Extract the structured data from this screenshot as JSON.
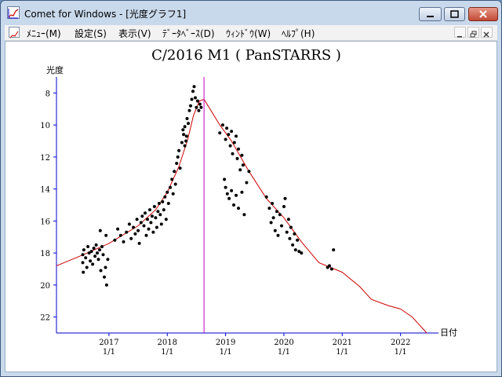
{
  "window": {
    "title": "Comet for Windows - [光度グラフ1]",
    "app_icon": "chart-icon"
  },
  "menu": {
    "items": [
      "ﾒﾆｭｰ(M)",
      "設定(S)",
      "表示(V)",
      "ﾃﾞｰﾀﾍﾞｰｽ(D)",
      "ｳｨﾝﾄﾞｳ(W)",
      "ﾍﾙﾌﾟ(H)"
    ]
  },
  "colors": {
    "axis": "#0000cc",
    "curve": "#cc0000",
    "marker_line": "#cc00cc",
    "points": "#000000"
  },
  "chart_data": {
    "type": "scatter",
    "title": "C/2016 M1 ( PanSTARRS )",
    "ylabel": "光度",
    "xlabel": "日付",
    "y_inverted": true,
    "ylim": [
      23,
      7
    ],
    "xlim": [
      2016.1,
      2022.65
    ],
    "y_ticks": [
      8,
      10,
      12,
      14,
      16,
      18,
      20,
      22
    ],
    "x_ticks": [
      {
        "year": 2017,
        "label_top": "2017",
        "label_bottom": "1/1"
      },
      {
        "year": 2018,
        "label_top": "2018",
        "label_bottom": "1/1"
      },
      {
        "year": 2019,
        "label_top": "2019",
        "label_bottom": "1/1"
      },
      {
        "year": 2020,
        "label_top": "2020",
        "label_bottom": "1/1"
      },
      {
        "year": 2021,
        "label_top": "2021",
        "label_bottom": "1/1"
      },
      {
        "year": 2022,
        "label_top": "2022",
        "label_bottom": "1/1"
      }
    ],
    "perihelion_line_x": 2018.63,
    "model_curve": {
      "x": [
        2016.1,
        2016.5,
        2017.0,
        2017.5,
        2017.8,
        2018.0,
        2018.2,
        2018.35,
        2018.45,
        2018.55,
        2018.63,
        2018.75,
        2018.9,
        2019.1,
        2019.4,
        2019.7,
        2020.0,
        2020.3,
        2020.6,
        2021.0,
        2021.3,
        2021.5,
        2021.8,
        2022.0,
        2022.2,
        2022.45
      ],
      "y": [
        18.8,
        18.2,
        17.4,
        16.3,
        15.3,
        14.2,
        12.6,
        10.9,
        9.4,
        8.5,
        8.4,
        9.1,
        10.0,
        11.0,
        12.9,
        14.6,
        15.8,
        17.3,
        18.6,
        19.2,
        20.1,
        20.9,
        21.3,
        21.5,
        22.0,
        23.0
      ]
    },
    "observations": [
      {
        "x": 2016.55,
        "y": 18.1
      },
      {
        "x": 2016.55,
        "y": 18.6
      },
      {
        "x": 2016.56,
        "y": 19.2
      },
      {
        "x": 2016.57,
        "y": 17.8
      },
      {
        "x": 2016.6,
        "y": 18.3
      },
      {
        "x": 2016.62,
        "y": 18.9
      },
      {
        "x": 2016.64,
        "y": 17.6
      },
      {
        "x": 2016.66,
        "y": 18.0
      },
      {
        "x": 2016.68,
        "y": 18.5
      },
      {
        "x": 2016.7,
        "y": 17.9
      },
      {
        "x": 2016.72,
        "y": 18.7
      },
      {
        "x": 2016.74,
        "y": 17.7
      },
      {
        "x": 2016.76,
        "y": 18.2
      },
      {
        "x": 2016.78,
        "y": 17.5
      },
      {
        "x": 2016.8,
        "y": 18.0
      },
      {
        "x": 2016.82,
        "y": 18.4
      },
      {
        "x": 2016.84,
        "y": 17.8
      },
      {
        "x": 2016.86,
        "y": 19.1
      },
      {
        "x": 2016.88,
        "y": 17.6
      },
      {
        "x": 2016.9,
        "y": 18.1
      },
      {
        "x": 2016.92,
        "y": 19.5
      },
      {
        "x": 2016.94,
        "y": 18.9
      },
      {
        "x": 2016.96,
        "y": 20.0
      },
      {
        "x": 2016.98,
        "y": 18.4
      },
      {
        "x": 2016.85,
        "y": 16.6
      },
      {
        "x": 2016.95,
        "y": 16.9
      },
      {
        "x": 2017.1,
        "y": 17.2
      },
      {
        "x": 2017.15,
        "y": 16.5
      },
      {
        "x": 2017.2,
        "y": 16.9
      },
      {
        "x": 2017.25,
        "y": 17.3
      },
      {
        "x": 2017.3,
        "y": 16.7
      },
      {
        "x": 2017.35,
        "y": 16.2
      },
      {
        "x": 2017.38,
        "y": 17.1
      },
      {
        "x": 2017.42,
        "y": 16.4
      },
      {
        "x": 2017.45,
        "y": 16.8
      },
      {
        "x": 2017.48,
        "y": 15.9
      },
      {
        "x": 2017.5,
        "y": 16.6
      },
      {
        "x": 2017.52,
        "y": 17.4
      },
      {
        "x": 2017.55,
        "y": 16.1
      },
      {
        "x": 2017.57,
        "y": 15.7
      },
      {
        "x": 2017.6,
        "y": 16.3
      },
      {
        "x": 2017.62,
        "y": 15.5
      },
      {
        "x": 2017.64,
        "y": 16.9
      },
      {
        "x": 2017.66,
        "y": 15.9
      },
      {
        "x": 2017.68,
        "y": 16.5
      },
      {
        "x": 2017.7,
        "y": 15.3
      },
      {
        "x": 2017.72,
        "y": 16.1
      },
      {
        "x": 2017.74,
        "y": 15.7
      },
      {
        "x": 2017.76,
        "y": 16.7
      },
      {
        "x": 2017.78,
        "y": 15.1
      },
      {
        "x": 2017.8,
        "y": 15.8
      },
      {
        "x": 2017.82,
        "y": 16.4
      },
      {
        "x": 2017.84,
        "y": 15.4
      },
      {
        "x": 2017.86,
        "y": 14.9
      },
      {
        "x": 2017.88,
        "y": 15.6
      },
      {
        "x": 2017.9,
        "y": 16.2
      },
      {
        "x": 2017.92,
        "y": 14.8
      },
      {
        "x": 2017.94,
        "y": 15.3
      },
      {
        "x": 2017.96,
        "y": 14.5
      },
      {
        "x": 2017.98,
        "y": 15.9
      },
      {
        "x": 2018.0,
        "y": 14.2
      },
      {
        "x": 2018.02,
        "y": 14.9
      },
      {
        "x": 2018.05,
        "y": 13.9
      },
      {
        "x": 2018.08,
        "y": 13.4
      },
      {
        "x": 2018.1,
        "y": 14.3
      },
      {
        "x": 2018.12,
        "y": 12.9
      },
      {
        "x": 2018.14,
        "y": 13.7
      },
      {
        "x": 2018.16,
        "y": 12.4
      },
      {
        "x": 2018.18,
        "y": 12.0
      },
      {
        "x": 2018.2,
        "y": 11.6
      },
      {
        "x": 2018.22,
        "y": 12.7
      },
      {
        "x": 2018.25,
        "y": 11.1
      },
      {
        "x": 2018.28,
        "y": 10.6
      },
      {
        "x": 2018.3,
        "y": 10.1
      },
      {
        "x": 2018.32,
        "y": 11.0
      },
      {
        "x": 2018.34,
        "y": 9.6
      },
      {
        "x": 2018.36,
        "y": 9.9
      },
      {
        "x": 2018.38,
        "y": 9.1
      },
      {
        "x": 2018.4,
        "y": 8.8
      },
      {
        "x": 2018.42,
        "y": 8.4
      },
      {
        "x": 2018.44,
        "y": 7.9
      },
      {
        "x": 2018.46,
        "y": 7.6
      },
      {
        "x": 2018.48,
        "y": 8.3
      },
      {
        "x": 2018.5,
        "y": 8.9
      },
      {
        "x": 2018.52,
        "y": 8.5
      },
      {
        "x": 2018.54,
        "y": 9.1
      },
      {
        "x": 2018.56,
        "y": 8.7
      },
      {
        "x": 2018.58,
        "y": 8.9
      },
      {
        "x": 2018.3,
        "y": 11.3
      },
      {
        "x": 2018.33,
        "y": 10.7
      },
      {
        "x": 2018.27,
        "y": 10.3
      },
      {
        "x": 2018.9,
        "y": 10.5
      },
      {
        "x": 2018.95,
        "y": 10.0
      },
      {
        "x": 2019.0,
        "y": 10.9
      },
      {
        "x": 2019.02,
        "y": 10.2
      },
      {
        "x": 2019.05,
        "y": 10.6
      },
      {
        "x": 2019.08,
        "y": 11.3
      },
      {
        "x": 2019.1,
        "y": 10.4
      },
      {
        "x": 2019.12,
        "y": 11.8
      },
      {
        "x": 2019.15,
        "y": 11.1
      },
      {
        "x": 2019.18,
        "y": 10.7
      },
      {
        "x": 2019.2,
        "y": 12.1
      },
      {
        "x": 2019.22,
        "y": 11.5
      },
      {
        "x": 2019.25,
        "y": 12.8
      },
      {
        "x": 2019.28,
        "y": 11.9
      },
      {
        "x": 2019.3,
        "y": 12.5
      },
      {
        "x": 2018.98,
        "y": 13.4
      },
      {
        "x": 2019.0,
        "y": 13.9
      },
      {
        "x": 2019.03,
        "y": 14.3
      },
      {
        "x": 2019.06,
        "y": 14.6
      },
      {
        "x": 2019.1,
        "y": 14.1
      },
      {
        "x": 2019.14,
        "y": 15.0
      },
      {
        "x": 2019.18,
        "y": 14.4
      },
      {
        "x": 2019.22,
        "y": 15.2
      },
      {
        "x": 2019.28,
        "y": 14.2
      },
      {
        "x": 2019.32,
        "y": 15.6
      },
      {
        "x": 2019.36,
        "y": 13.6
      },
      {
        "x": 2019.4,
        "y": 12.9
      },
      {
        "x": 2019.7,
        "y": 14.5
      },
      {
        "x": 2019.75,
        "y": 15.2
      },
      {
        "x": 2019.78,
        "y": 16.1
      },
      {
        "x": 2019.8,
        "y": 14.9
      },
      {
        "x": 2019.82,
        "y": 15.8
      },
      {
        "x": 2019.85,
        "y": 16.6
      },
      {
        "x": 2019.88,
        "y": 15.4
      },
      {
        "x": 2019.9,
        "y": 16.9
      },
      {
        "x": 2019.93,
        "y": 15.6
      },
      {
        "x": 2019.96,
        "y": 16.3
      },
      {
        "x": 2020.0,
        "y": 15.1
      },
      {
        "x": 2020.02,
        "y": 14.6
      },
      {
        "x": 2020.05,
        "y": 16.7
      },
      {
        "x": 2020.08,
        "y": 15.9
      },
      {
        "x": 2020.1,
        "y": 17.1
      },
      {
        "x": 2020.12,
        "y": 16.4
      },
      {
        "x": 2020.15,
        "y": 17.5
      },
      {
        "x": 2020.18,
        "y": 16.8
      },
      {
        "x": 2020.2,
        "y": 17.8
      },
      {
        "x": 2020.23,
        "y": 17.2
      },
      {
        "x": 2020.26,
        "y": 17.9
      },
      {
        "x": 2020.3,
        "y": 18.0
      },
      {
        "x": 2020.75,
        "y": 18.9
      },
      {
        "x": 2020.78,
        "y": 18.8
      },
      {
        "x": 2020.82,
        "y": 19.0
      },
      {
        "x": 2020.85,
        "y": 17.8
      }
    ]
  }
}
